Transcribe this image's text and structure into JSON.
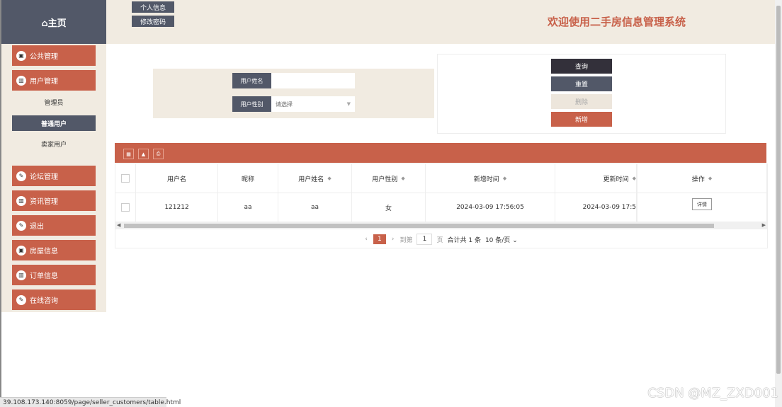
{
  "sidebar": {
    "home_label": "⌂主页",
    "items": [
      {
        "label": "公共管理",
        "icon": "bus-icon"
      },
      {
        "label": "用户管理",
        "icon": "chart-icon"
      },
      {
        "label": "论坛管理",
        "icon": "edit-icon"
      },
      {
        "label": "资讯管理",
        "icon": "chart-icon"
      },
      {
        "label": "退出",
        "icon": "edit-icon"
      },
      {
        "label": "房屋信息",
        "icon": "bus-icon"
      },
      {
        "label": "订单信息",
        "icon": "chart-icon"
      },
      {
        "label": "在线咨询",
        "icon": "edit-icon"
      }
    ],
    "sub_items": [
      {
        "label": "管理员"
      },
      {
        "label": "普通用户"
      },
      {
        "label": "卖家用户"
      }
    ]
  },
  "header": {
    "profile_label": "个人信息",
    "password_label": "修改密码",
    "welcome": "欢迎使用二手房信息管理系统"
  },
  "search": {
    "name_label": "用户姓名",
    "name_value": "",
    "gender_label": "用户性别",
    "gender_placeholder": "请选择"
  },
  "actions": {
    "query": "查询",
    "reset": "重置",
    "delete": "删除",
    "add": "新增"
  },
  "table": {
    "columns": [
      "用户名",
      "昵称",
      "用户姓名",
      "用户性别",
      "新增时间",
      "更新时间",
      "操作"
    ],
    "rows": [
      {
        "username": "121212",
        "nickname": "aa",
        "name": "aa",
        "gender": "女",
        "created": "2024-03-09 17:56:05",
        "updated": "2024-03-09 17:5",
        "action": "详情"
      }
    ]
  },
  "pagination": {
    "current": "1",
    "goto_label": "到第",
    "goto_value": "1",
    "page_suffix": "页",
    "total": "合计共 1 条",
    "page_size": "10 条/页"
  },
  "status_url": "39.108.173.140:8059/page/seller_customers/table.html",
  "watermark": "CSDN @MZ_ZXD001",
  "colors": {
    "accent": "#c8614a",
    "dark": "#525868",
    "beige": "#f1ebe1"
  }
}
